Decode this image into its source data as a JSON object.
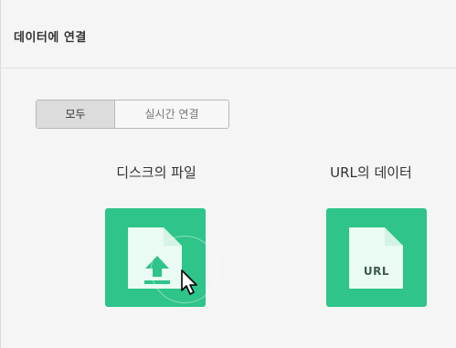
{
  "header": {
    "title": "데이터에 연결"
  },
  "tabs": [
    {
      "label": "모두",
      "active": true
    },
    {
      "label": "실시간 연결",
      "active": false
    }
  ],
  "sources": [
    {
      "label": "디스크의 파일",
      "icon": "file-upload-icon"
    },
    {
      "label": "URL의 데이터",
      "icon": "file-url-icon",
      "badge": "URL"
    }
  ],
  "colors": {
    "tile_green": "#2ec48a",
    "page_bg": "#f5f5f5"
  }
}
